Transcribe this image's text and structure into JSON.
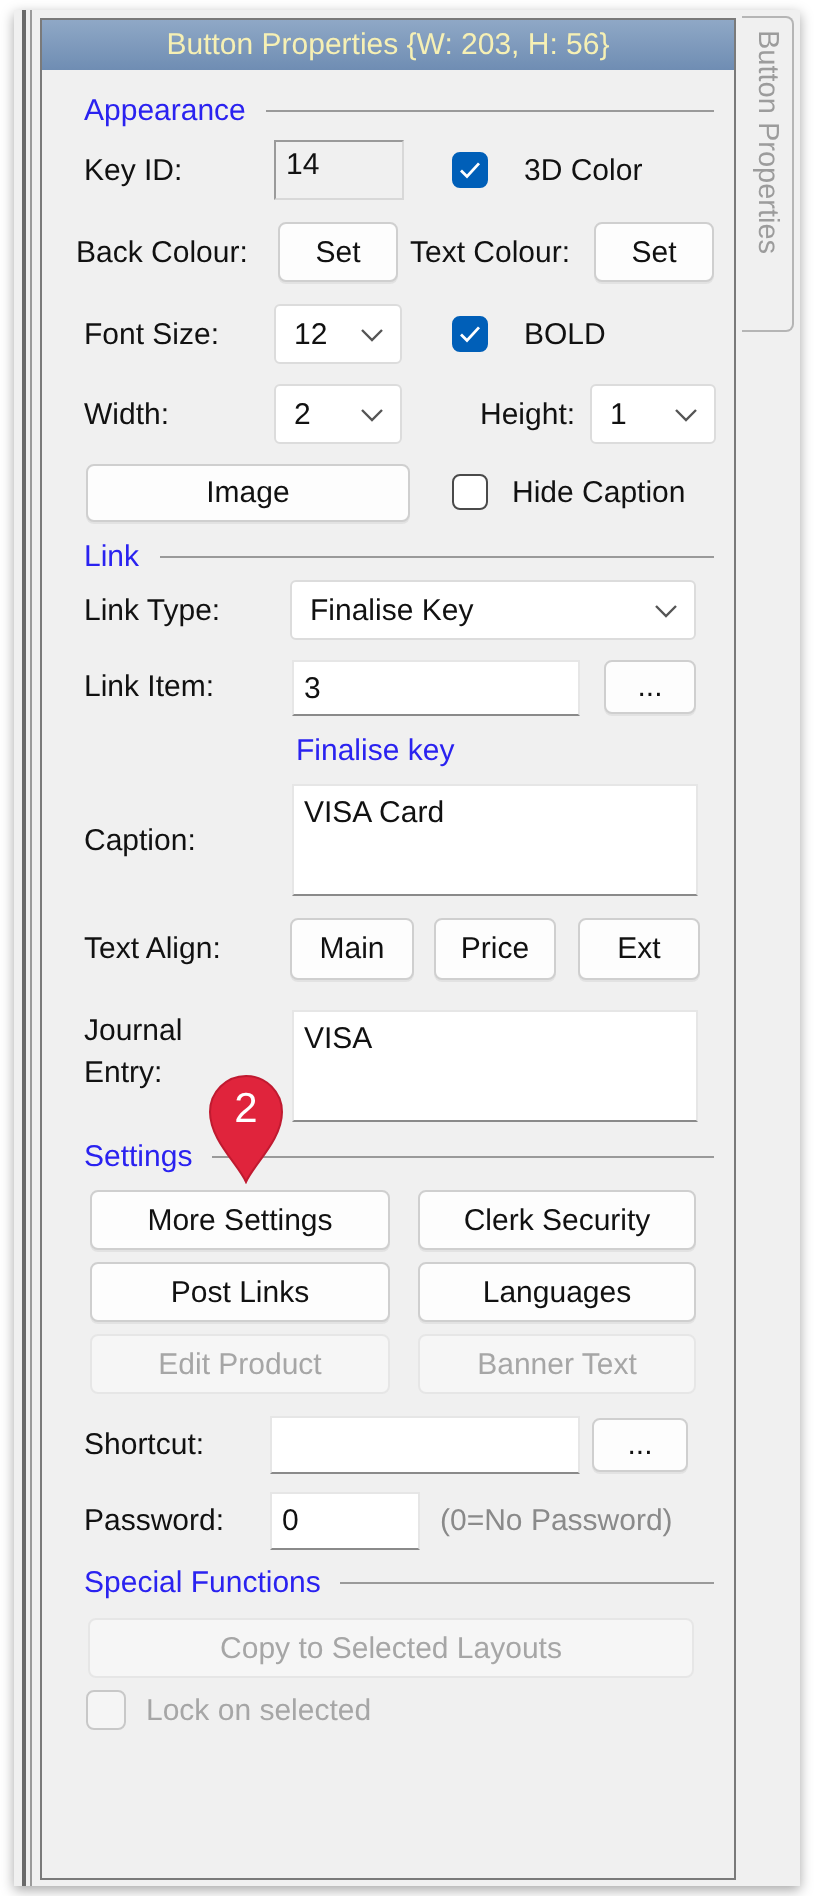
{
  "window": {
    "title": "Button Properties {W: 203, H: 56}"
  },
  "side_tab": {
    "label": "Button Properties"
  },
  "appearance": {
    "heading": "Appearance",
    "key_id": {
      "label": "Key ID:",
      "value": "14"
    },
    "color_3d": {
      "label": "3D Color",
      "checked": true
    },
    "back_colour": {
      "label": "Back Colour:",
      "button": "Set"
    },
    "text_colour": {
      "label": "Text Colour:",
      "button": "Set"
    },
    "font_size": {
      "label": "Font Size:",
      "value": "12"
    },
    "bold": {
      "label": "BOLD",
      "checked": true
    },
    "width": {
      "label": "Width:",
      "value": "2"
    },
    "height": {
      "label": "Height:",
      "value": "1"
    },
    "image_button": "Image",
    "hide_caption": {
      "label": "Hide Caption",
      "checked": false
    }
  },
  "link": {
    "heading": "Link",
    "link_type": {
      "label": "Link Type:",
      "value": "Finalise Key"
    },
    "link_item": {
      "label": "Link Item:",
      "value": "3",
      "button": "..."
    },
    "link_description": "Finalise key",
    "caption": {
      "label": "Caption:",
      "value": "VISA Card"
    },
    "text_align": {
      "label": "Text Align:",
      "buttons": [
        "Main",
        "Price",
        "Ext"
      ]
    },
    "journal_entry": {
      "label": "Journal Entry:",
      "value": "VISA"
    }
  },
  "settings": {
    "heading": "Settings",
    "buttons": [
      {
        "label": "More Settings",
        "disabled": false
      },
      {
        "label": "Clerk Security",
        "disabled": false
      },
      {
        "label": "Post Links",
        "disabled": false
      },
      {
        "label": "Languages",
        "disabled": false
      },
      {
        "label": "Edit Product",
        "disabled": true
      },
      {
        "label": "Banner Text",
        "disabled": true
      }
    ],
    "shortcut": {
      "label": "Shortcut:",
      "button": "..."
    },
    "password": {
      "label": "Password:",
      "value": "0",
      "hint": "(0=No Password)"
    }
  },
  "special_functions": {
    "heading": "Special Functions",
    "copy_button": {
      "label": "Copy to Selected Layouts",
      "disabled": true
    },
    "lock_on_selected": {
      "label": "Lock on selected",
      "checked": false,
      "disabled": true
    }
  },
  "callout": {
    "number": "2"
  }
}
